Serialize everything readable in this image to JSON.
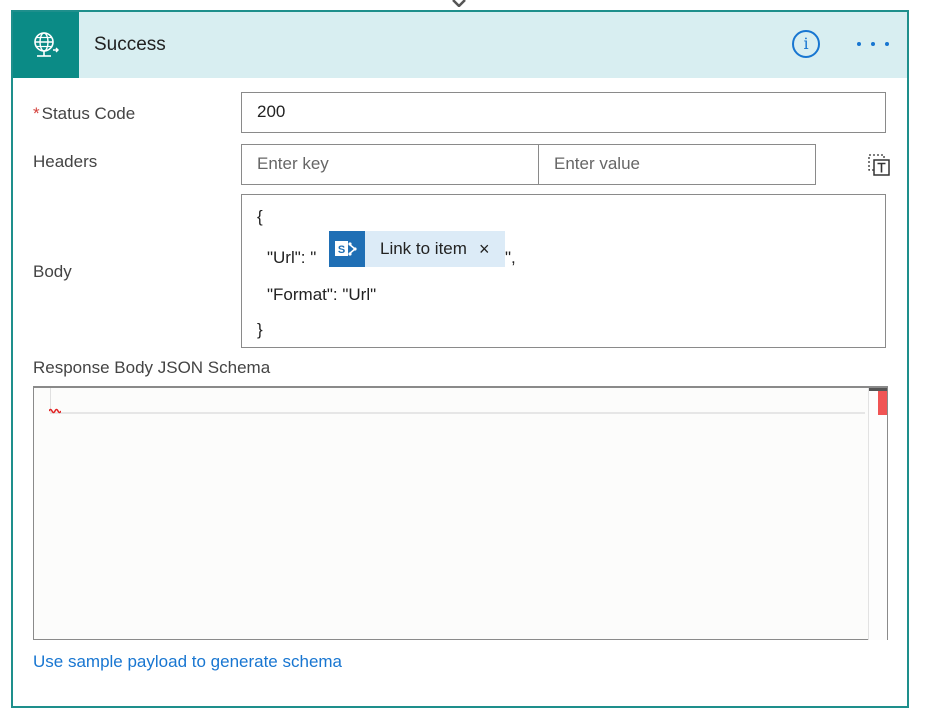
{
  "action": {
    "title": "Success",
    "icon": "globe-request-icon",
    "accent_color": "#0b8b86",
    "header_bg": "#d8eef1"
  },
  "header_actions": {
    "info_glyph": "i",
    "info_icon": "info-icon",
    "more_icon": "ellipsis-icon"
  },
  "fields": {
    "status_code": {
      "required_mark": "*",
      "label": "Status Code",
      "value": "200"
    },
    "headers": {
      "label": "Headers",
      "key_placeholder": "Enter key",
      "value_placeholder": "Enter value",
      "switch_icon": "text-mode-icon"
    },
    "body": {
      "label": "Body",
      "lines": {
        "l1": "{",
        "l2_prefix": "\"Url\": \"",
        "l2_suffix": "\",",
        "l3": "\"Format\": \"Url\"",
        "l4": "}"
      },
      "token": {
        "label": "Link to item",
        "close_glyph": "×",
        "icon": "sharepoint-icon"
      }
    },
    "schema": {
      "label": "Response Body JSON Schema",
      "error_color": "#f05454"
    }
  },
  "links": {
    "sample_payload": "Use sample payload to generate schema"
  }
}
